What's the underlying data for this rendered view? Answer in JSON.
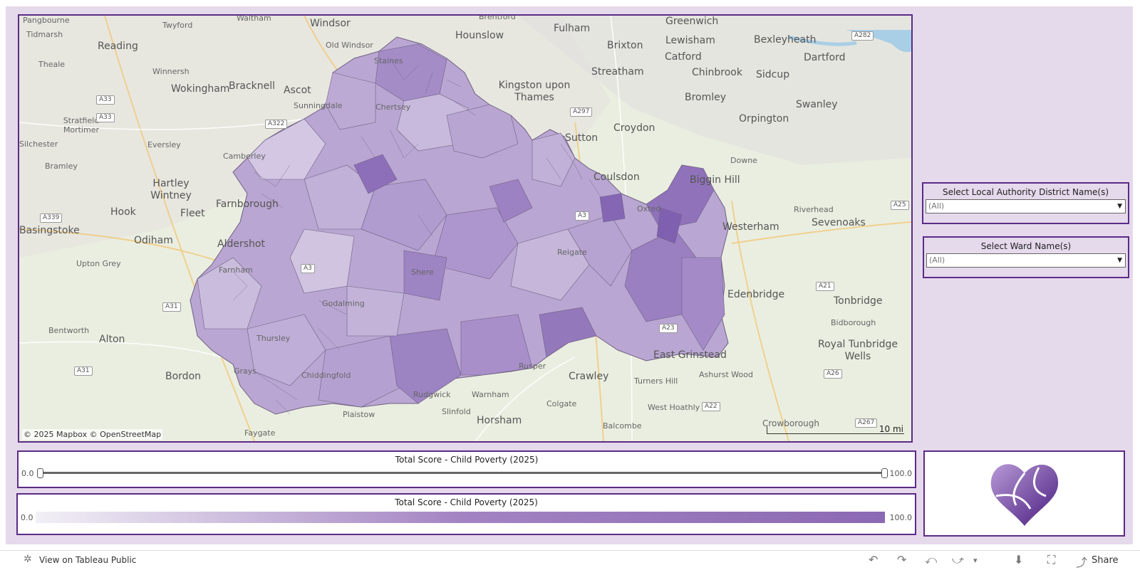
{
  "map": {
    "attribution": "© 2025 Mapbox  © OpenStreetMap",
    "scale_label": "10 mi",
    "place_labels_big": [
      "Windsor",
      "Hounslow",
      "Fulham",
      "Brixton",
      "Greenwich",
      "Lewisham",
      "Bexleyheath",
      "Dartford",
      "Reading",
      "Wokingham",
      "Bracknell",
      "Ascot",
      "Kingston upon Thames",
      "Streatham",
      "Catford",
      "Chinbrook",
      "Sidcup",
      "Bromley",
      "Swanley",
      "Orpington",
      "Sutton",
      "Croydon",
      "Hartley Wintney",
      "Fleet",
      "Hook",
      "Odiham",
      "Farnborough",
      "Aldershot",
      "Basingstoke",
      "Alton",
      "Bordon",
      "Crawley",
      "Horsham",
      "East Grinstead",
      "Sevenoaks",
      "Westerham",
      "Biggin Hill",
      "Tonbridge",
      "Royal Tunbridge Wells",
      "Coulsdon",
      "Edenbridge"
    ],
    "place_labels_small": [
      "Pangbourne",
      "Tidmarsh",
      "Twyford",
      "Waltham",
      "Old Windsor",
      "Brentford",
      "Theale",
      "Winnersh",
      "Sunningdale",
      "Stratfield Mortimer",
      "Silchester",
      "Eversley",
      "Bramley",
      "Upton Grey",
      "Bentworth",
      "Downe",
      "Riverhead",
      "Bidborough",
      "Ashurst Wood",
      "Turners Hill",
      "West Hoathly",
      "Colgate",
      "Warnham",
      "Rudgwick",
      "Plaistow",
      "Slinfold",
      "Rusper",
      "Balcombe",
      "Crowborough",
      "Grays",
      "Chiddingfold",
      "Faygate",
      "Shere",
      "Reigate",
      "Godalming",
      "Farnham",
      "Thursley",
      "Oxted",
      "Camberley",
      "Chertsey",
      "Staines"
    ],
    "roads": [
      "A282",
      "A33",
      "A33",
      "A322",
      "A297",
      "A339",
      "A25",
      "A31",
      "A31",
      "A21",
      "A26",
      "A22",
      "A267",
      "A3",
      "A3",
      "A23"
    ]
  },
  "filters": {
    "district": {
      "title": "Select Local Authority District Name(s)",
      "value": "(All)"
    },
    "ward": {
      "title": "Select Ward Name(s)",
      "value": "(All)"
    }
  },
  "slider": {
    "title": "Total Score - Child Poverty (2025)",
    "min": "0.0",
    "max": "100.0"
  },
  "legend": {
    "title": "Total Score - Child Poverty (2025)",
    "min": "0.0",
    "max": "100.0"
  },
  "footer": {
    "view_link": "View on Tableau Public",
    "share": "Share"
  },
  "colors": {
    "accent": "#5b2b86",
    "dashboard_bg": "#e5d9ec",
    "ramp_low": "#f2f0f6",
    "ramp_high": "#8c69b3"
  }
}
